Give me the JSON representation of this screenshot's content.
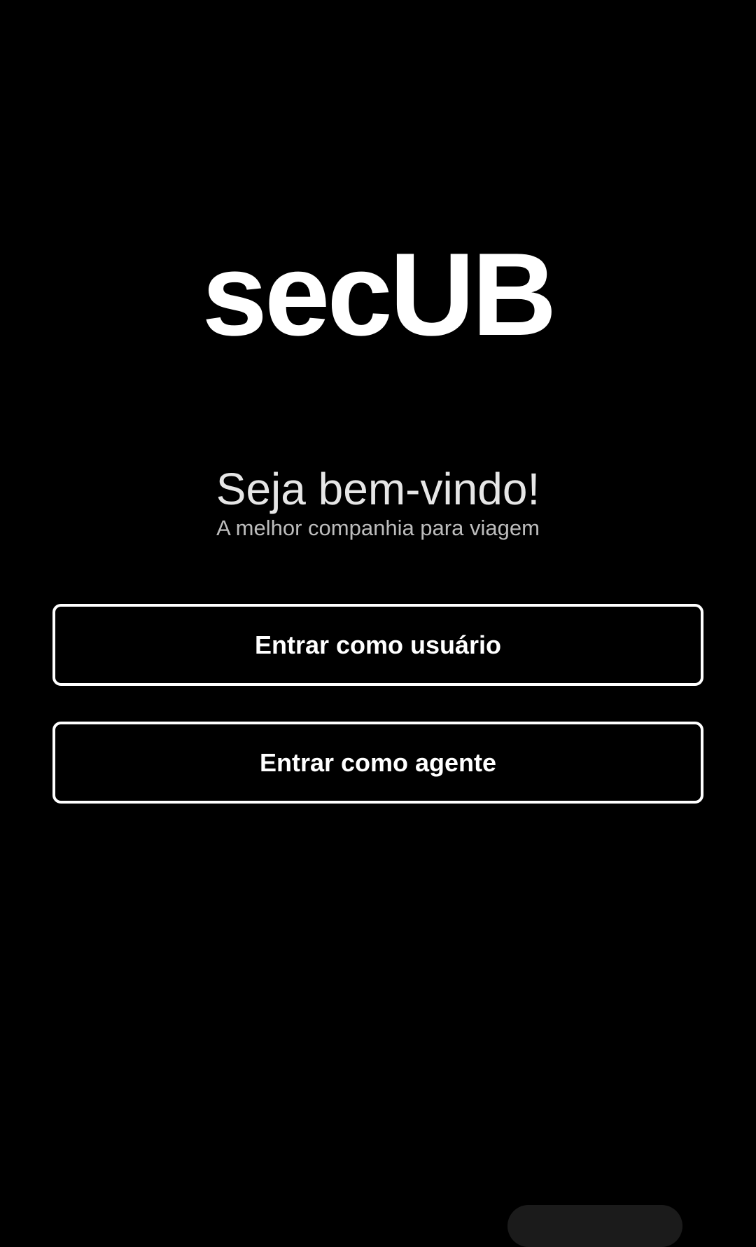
{
  "app": {
    "logo_text": "secUB"
  },
  "welcome": {
    "title": "Seja bem-vindo!",
    "subtitle": "A melhor companhia para viagem"
  },
  "actions": {
    "login_user_label": "Entrar como usuário",
    "login_agent_label": "Entrar como agente"
  },
  "colors": {
    "background": "#000000",
    "foreground": "#ffffff"
  }
}
